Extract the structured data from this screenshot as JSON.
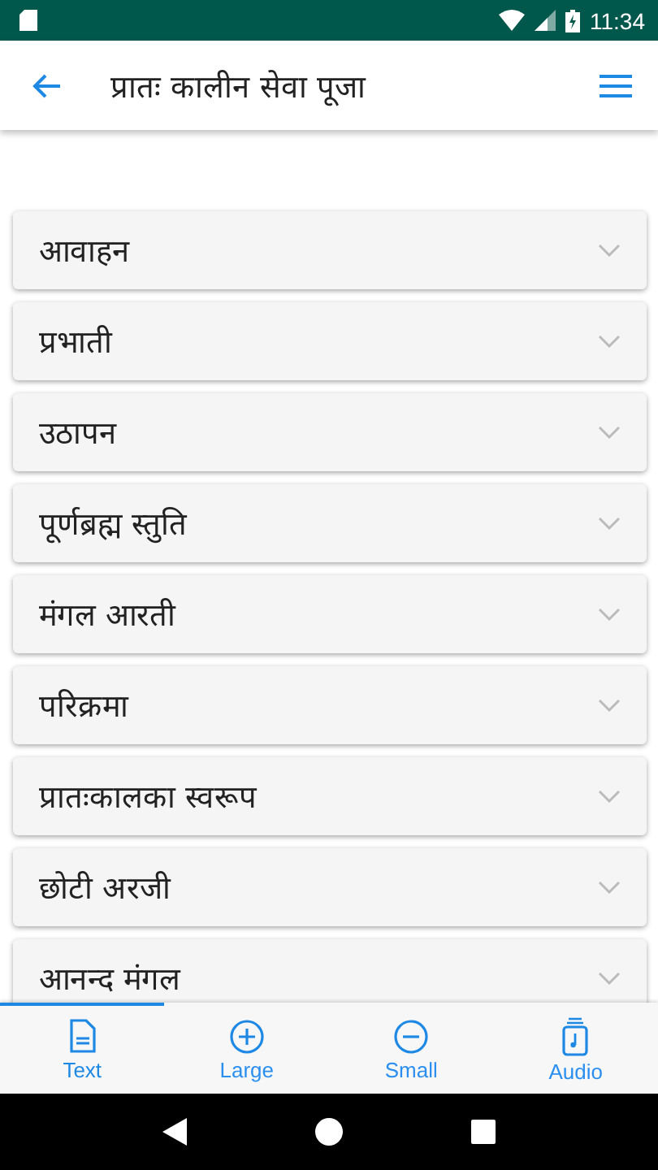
{
  "status_bar": {
    "time": "11:34"
  },
  "app_bar": {
    "title": "प्रातः कालीन सेवा पूजा"
  },
  "sections": [
    {
      "title": "आवाहन",
      "expanded": false
    },
    {
      "title": "प्रभाती",
      "expanded": false
    },
    {
      "title": "उठापन",
      "expanded": false
    },
    {
      "title": "पूर्णब्रह्म स्तुति",
      "expanded": false
    },
    {
      "title": "मंगल आरती",
      "expanded": false
    },
    {
      "title": "परिक्रमा",
      "expanded": false
    },
    {
      "title": "प्रातःकालका स्वरूप",
      "expanded": false
    },
    {
      "title": "छोटी अरजी",
      "expanded": false
    },
    {
      "title": "आनन्द मंगल",
      "expanded": false
    }
  ],
  "tabs": [
    {
      "label": "Text",
      "kind": "text",
      "selected": true
    },
    {
      "label": "Large",
      "kind": "large",
      "selected": false
    },
    {
      "label": "Small",
      "kind": "small",
      "selected": false
    },
    {
      "label": "Audio",
      "kind": "audio",
      "selected": false
    }
  ]
}
